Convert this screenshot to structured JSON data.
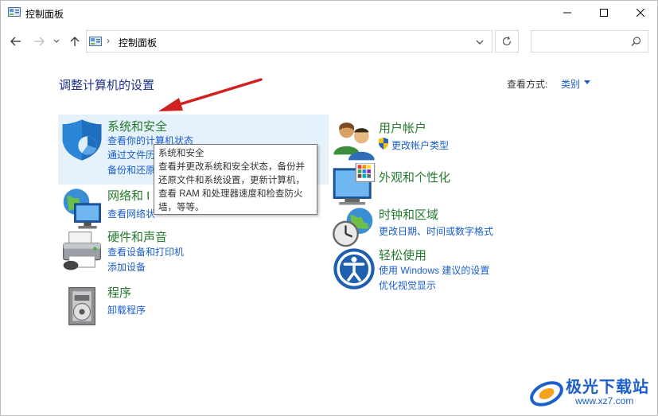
{
  "window": {
    "title": "控制面板",
    "controls": {
      "minimize": "─",
      "maximize": "☐",
      "close": "✕"
    }
  },
  "address_bar": {
    "separator": "›",
    "path": "控制面板",
    "search_placeholder": ""
  },
  "header": {
    "title": "调整计算机的设置",
    "view_label": "查看方式:",
    "view_value": "类别"
  },
  "categories": [
    {
      "title": "系统和安全",
      "links": [
        "查看你的计算机状态",
        "通过文件历",
        "备份和还原"
      ],
      "icon": "shield-icon"
    },
    {
      "title": "网络和 I",
      "links": [
        "查看网络状"
      ],
      "icon": "network-globe-icon"
    },
    {
      "title": "硬件和声音",
      "links": [
        "查看设备和打印机",
        "添加设备"
      ],
      "icon": "printer-icon"
    },
    {
      "title": "程序",
      "links": [
        "卸载程序"
      ],
      "icon": "programs-icon"
    },
    {
      "title": "用户帐户",
      "links": [
        "更改帐户类型"
      ],
      "icon": "users-icon"
    },
    {
      "title": "外观和个性化",
      "links": [],
      "icon": "monitor-palette-icon"
    },
    {
      "title": "时钟和区域",
      "links": [
        "更改日期、时间或数字格式"
      ],
      "icon": "clock-globe-icon"
    },
    {
      "title": "轻松使用",
      "links": [
        "使用 Windows 建议的设置",
        "优化视觉显示"
      ],
      "icon": "accessibility-icon"
    }
  ],
  "tooltip": {
    "title": "系统和安全",
    "lines": [
      "查看并更改系统和安全状态，备份并",
      "还原文件和系统设置，更新计算机，",
      "查看 RAM 和处理器速度和检查防火",
      "墙，等等。"
    ]
  },
  "watermark": {
    "brand": "极光下载站",
    "url": "www.xz7.com"
  },
  "colors": {
    "link": "#1a5ec9",
    "category_title": "#267a2e",
    "page_title": "#1e3287",
    "highlight": "#e5f1fb",
    "arrow": "#d02020"
  }
}
